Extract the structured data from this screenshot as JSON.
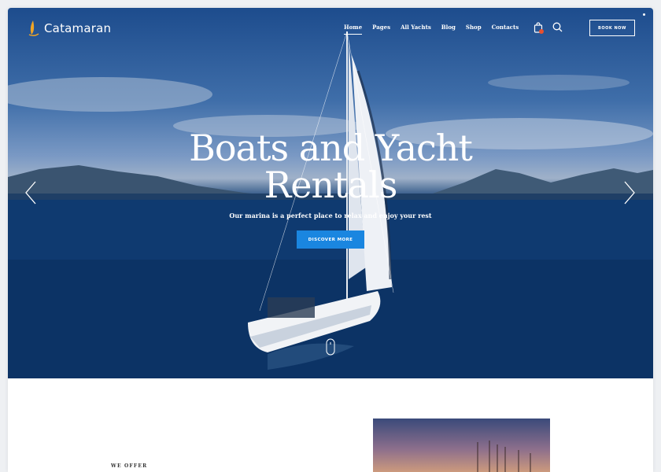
{
  "brand": {
    "name": "Catamaran"
  },
  "nav": {
    "items": [
      {
        "label": "Home",
        "active": true
      },
      {
        "label": "Pages"
      },
      {
        "label": "All Yachts"
      },
      {
        "label": "Blog"
      },
      {
        "label": "Shop"
      },
      {
        "label": "Contacts"
      }
    ]
  },
  "header": {
    "book_label": "BOOK NOW",
    "cart_icon": "shopping-bag-icon",
    "search_icon": "search-icon"
  },
  "hero": {
    "title_line1": "Boats and Yacht",
    "title_line2": "Rentals",
    "subtitle": "Our marina is a perfect place to relax and enjoy your rest",
    "cta_label": "DISCOVER MORE",
    "prev_icon": "chevron-left-icon",
    "next_icon": "chevron-right-icon",
    "scroll_icon": "mouse-scroll-icon"
  },
  "section": {
    "offer_label": "WE OFFER"
  },
  "colors": {
    "accent": "#1a86e0",
    "badge": "#e8502e",
    "sea": "#0d3566"
  }
}
